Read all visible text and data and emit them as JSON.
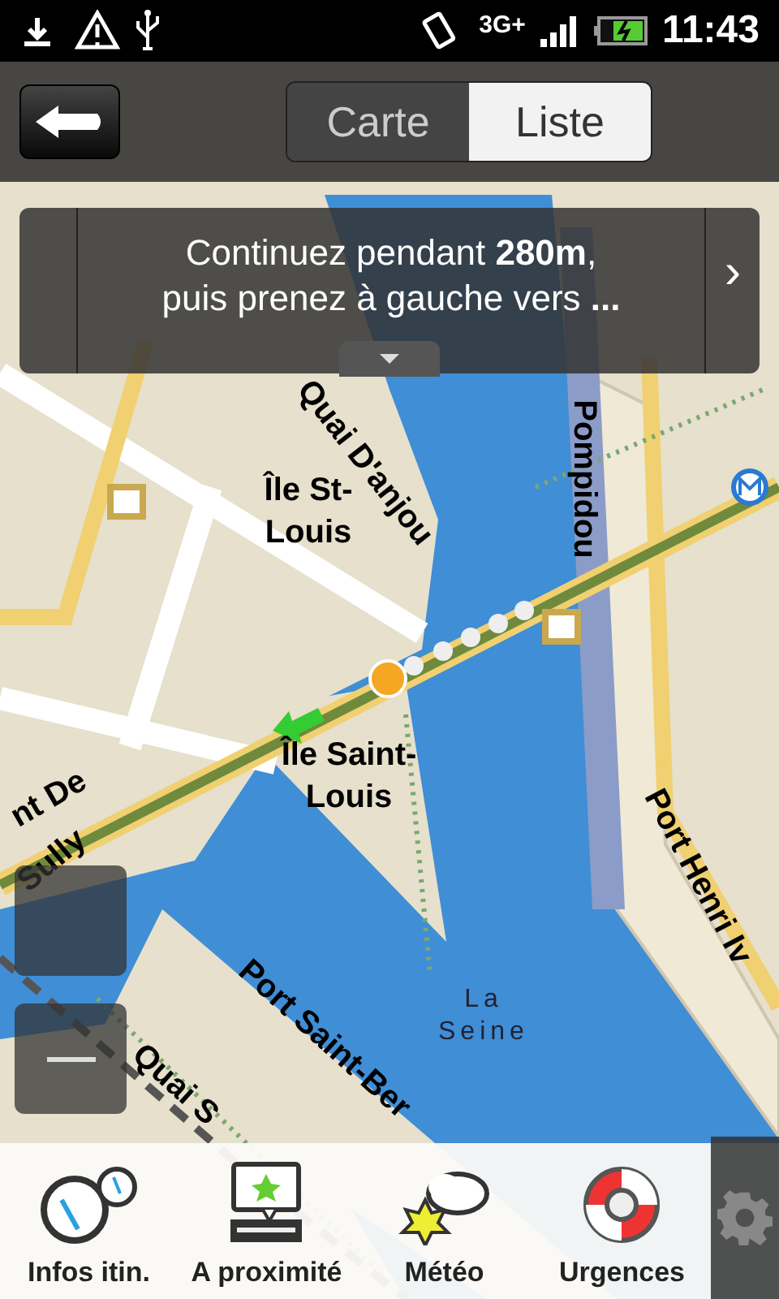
{
  "status_bar": {
    "network": "3G+",
    "time": "11:43"
  },
  "header": {
    "tabs": [
      {
        "label": "Carte",
        "selected": false
      },
      {
        "label": "Liste",
        "selected": true
      }
    ]
  },
  "instruction": {
    "text": "Continuez pendant **280m**,\npuis prenez à gauche vers **...**",
    "next": "›"
  },
  "map": {
    "labels": [
      {
        "text": "Quai D'anjou"
      },
      {
        "text": "Île St-\nLouis"
      },
      {
        "text": "Pompidou"
      },
      {
        "text": "Île Saint-\nLouis"
      },
      {
        "text": "Port Henri Iv"
      },
      {
        "text": "nt De"
      },
      {
        "text": "Sully"
      },
      {
        "text": "Port Saint-Ber"
      },
      {
        "text": "Quai S"
      }
    ],
    "water_label": "La\nSeine"
  },
  "toolbar": {
    "items": [
      {
        "kind": "gauge",
        "label": "Infos itin."
      },
      {
        "kind": "nearby",
        "label": "A proximité"
      },
      {
        "kind": "weather",
        "label": "Météo"
      },
      {
        "kind": "lifebuoy",
        "label": "Urgences"
      }
    ]
  }
}
